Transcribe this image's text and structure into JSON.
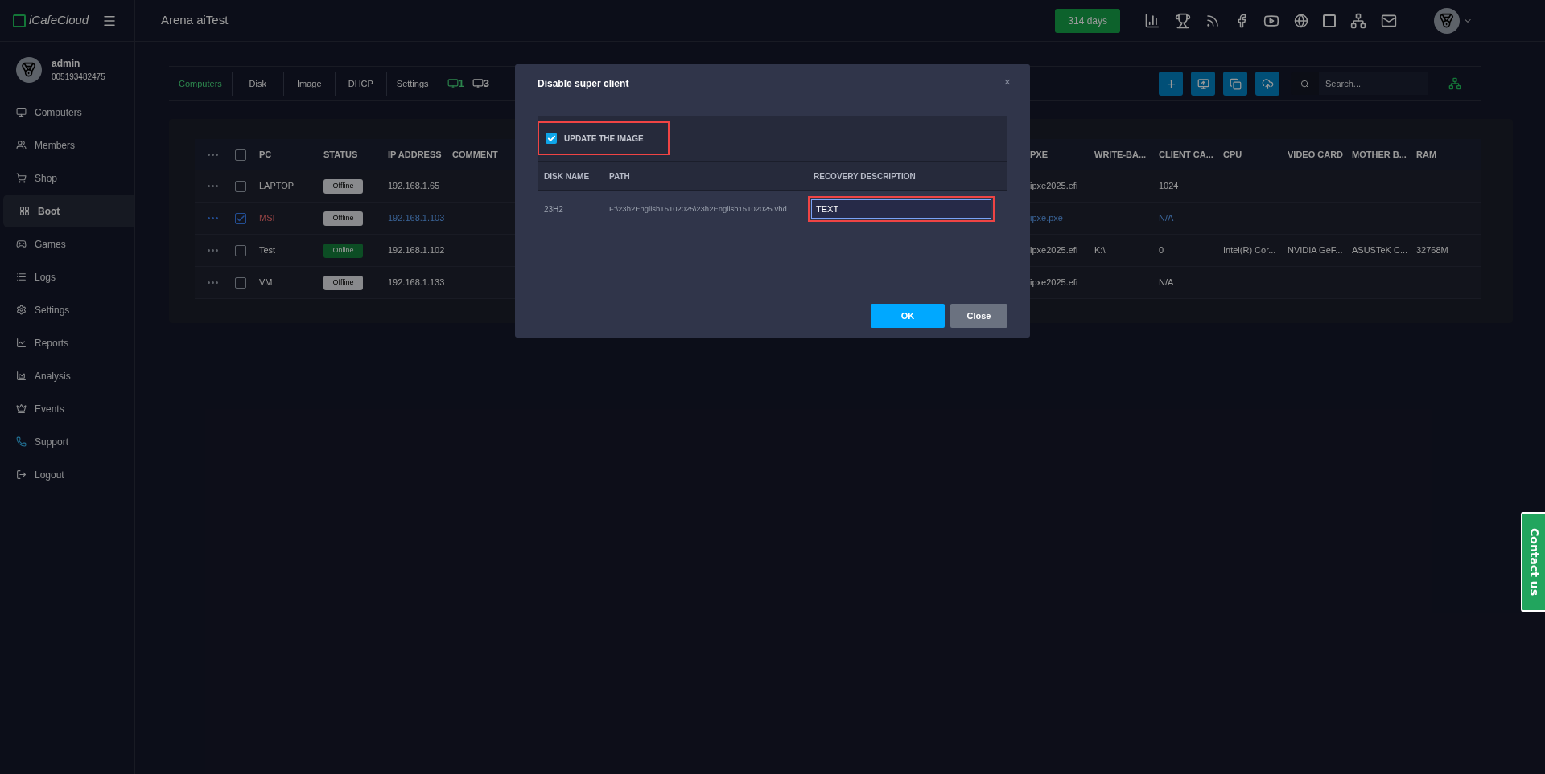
{
  "brand": "iCafeCloud",
  "site_title": "Arena aiTest",
  "license_badge": "314 days",
  "user": {
    "name": "admin",
    "id": "005193482475"
  },
  "sidebar": {
    "items": [
      {
        "label": "Computers",
        "selected": false
      },
      {
        "label": "Members",
        "selected": false
      },
      {
        "label": "Shop",
        "selected": false
      },
      {
        "label": "Boot",
        "selected": true
      },
      {
        "label": "Games",
        "selected": false
      },
      {
        "label": "Logs",
        "selected": false
      },
      {
        "label": "Settings",
        "selected": false
      },
      {
        "label": "Reports",
        "selected": false
      },
      {
        "label": "Analysis",
        "selected": false
      },
      {
        "label": "Events",
        "selected": false
      },
      {
        "label": "Support",
        "selected": false
      },
      {
        "label": "Logout",
        "selected": false
      }
    ]
  },
  "tabs": [
    {
      "label": "Computers",
      "selected": true
    },
    {
      "label": "Disk",
      "selected": false
    },
    {
      "label": "Image",
      "selected": false
    },
    {
      "label": "DHCP",
      "selected": false
    },
    {
      "label": "Settings",
      "selected": false
    }
  ],
  "monitor_counts": [
    {
      "count": "1",
      "active": true
    },
    {
      "count": "3",
      "active": false
    }
  ],
  "search": {
    "placeholder": "Search..."
  },
  "table": {
    "columns_left": [
      "PC",
      "STATUS",
      "IP ADDRESS",
      "COMMENT"
    ],
    "columns_right": [
      "PXE",
      "WRITE-BA...",
      "CLIENT CA...",
      "CPU",
      "VIDEO CARD",
      "MOTHER B...",
      "RAM"
    ],
    "header_checked": false,
    "rows": [
      {
        "selected": false,
        "pc": "LAPTOP",
        "status": "Offline",
        "online": false,
        "ip": "192.168.1.65",
        "pxe": "ipxe2025.efi",
        "column_7": "1024"
      },
      {
        "selected": true,
        "pc": "MSI",
        "status": "Offline",
        "online": false,
        "ip": "192.168.1.103",
        "pxe": "ipxe.pxe",
        "column_7": "N/A"
      },
      {
        "selected": false,
        "pc": "Test",
        "status": "Online",
        "online": true,
        "ip": "192.168.1.102",
        "pxe": "ipxe2025.efi",
        "column_6": "K:\\",
        "column_7": "0",
        "cpu": "Intel(R) Cor...",
        "video_card": "NVIDIA GeF...",
        "column_10": "ASUSTeK C...",
        "ram": "32768M"
      },
      {
        "selected": false,
        "pc": "VM",
        "status": "Offline",
        "online": false,
        "ip": "192.168.1.133",
        "pxe": "ipxe2025.efi",
        "column_7": "N/A"
      }
    ]
  },
  "dialog": {
    "title": "Disable super client",
    "close": "×",
    "update_image": {
      "label": "UPDATE THE IMAGE",
      "checked": true
    },
    "columns": [
      "DISK NAME",
      "PATH",
      "RECOVERY DESCRIPTION"
    ],
    "row": {
      "disk_name": "23H2",
      "path": "F:\\23h2English15102025\\23h2English15102025.vhd",
      "recovery_description": "TEXT"
    },
    "buttons": [
      "OK",
      "Close"
    ]
  },
  "contact": "Contact us"
}
